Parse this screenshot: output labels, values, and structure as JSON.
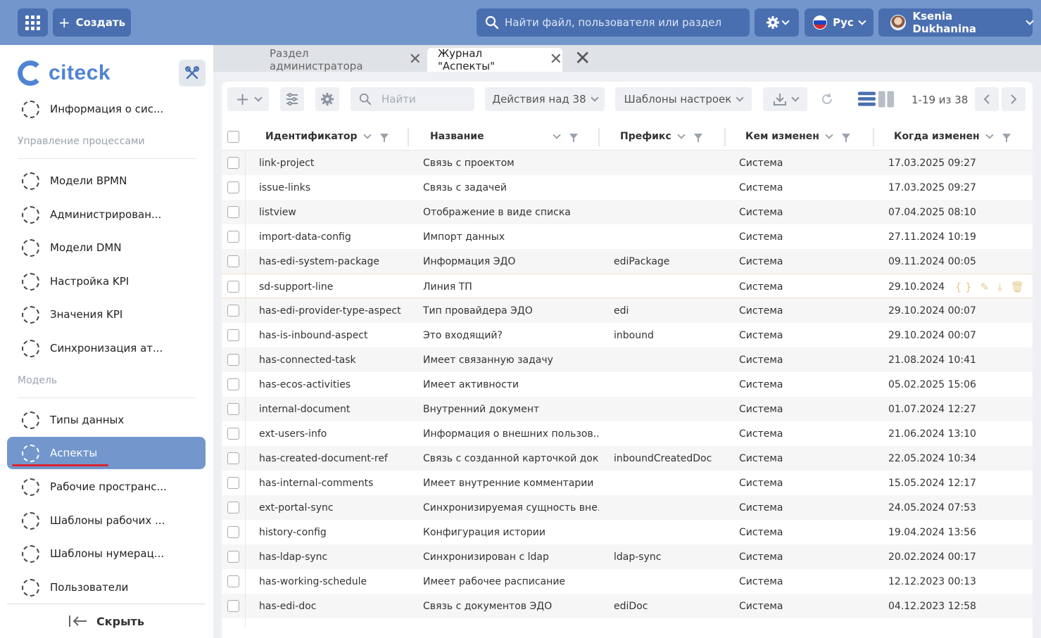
{
  "topbar": {
    "create_label": "Создать",
    "search_placeholder": "Найти файл, пользователя или раздел",
    "language": "Рус",
    "user_name": "Ksenia Dukhanina"
  },
  "sidebar": {
    "logo_text": "citeck",
    "top_item": "Информация о сис...",
    "section_processes": "Управление процессами",
    "process_items": [
      "Модели BPMN",
      "Администрирован...",
      "Модели DMN",
      "Настройка KPI",
      "Значения KPI",
      "Синхронизация ат..."
    ],
    "section_model": "Модель",
    "model_items": [
      "Типы данных",
      "Аспекты",
      "Рабочие пространс...",
      "Шаблоны рабочих ...",
      "Шаблоны нумерац...",
      "Пользователи"
    ],
    "active_item": "Аспекты",
    "hide_label": "Скрыть"
  },
  "tabs": [
    {
      "label": "Раздел администратора",
      "active": false
    },
    {
      "label": "Журнал \"Аспекты\"",
      "active": true
    }
  ],
  "toolbar": {
    "search_placeholder": "Найти",
    "actions_label": "Действия над 38",
    "templates_label": "Шаблоны настроек",
    "pager": "1-19 из 38"
  },
  "table": {
    "columns": [
      "Идентификатор",
      "Название",
      "Префикс",
      "Кем изменен",
      "Когда изменен"
    ],
    "rows": [
      [
        "link-project",
        "Связь с проектом",
        "",
        "Система",
        "17.03.2025 09:27"
      ],
      [
        "issue-links",
        "Связь с задачей",
        "",
        "Система",
        "17.03.2025 09:27"
      ],
      [
        "listview",
        "Отображение в виде списка",
        "",
        "Система",
        "07.04.2025 08:10"
      ],
      [
        "import-data-config",
        "Импорт данных",
        "",
        "Система",
        "27.11.2024 10:19"
      ],
      [
        "has-edi-system-package",
        "Информация ЭДО",
        "ediPackage",
        "Система",
        "09.11.2024 00:05"
      ],
      [
        "sd-support-line",
        "Линия ТП",
        "",
        "Система",
        "29.10.2024"
      ],
      [
        "has-edi-provider-type-aspect",
        "Тип провайдера ЭДО",
        "edi",
        "Система",
        "29.10.2024 00:07"
      ],
      [
        "has-is-inbound-aspect",
        "Это входящий?",
        "inbound",
        "Система",
        "29.10.2024 00:07"
      ],
      [
        "has-connected-task",
        "Имеет связанную задачу",
        "",
        "Система",
        "21.08.2024 10:41"
      ],
      [
        "has-ecos-activities",
        "Имеет активности",
        "",
        "Система",
        "05.02.2025 15:06"
      ],
      [
        "internal-document",
        "Внутренний документ",
        "",
        "Система",
        "01.07.2024 12:27"
      ],
      [
        "ext-users-info",
        "Информация о внешних пользов...",
        "",
        "Система",
        "21.06.2024 13:10"
      ],
      [
        "has-created-document-ref",
        "Связь с созданной карточкой док...",
        "inboundCreatedDoc",
        "Система",
        "22.05.2024 10:34"
      ],
      [
        "has-internal-comments",
        "Имеет внутренние комментарии",
        "",
        "Система",
        "15.05.2024 12:17"
      ],
      [
        "ext-portal-sync",
        "Синхронизируемая сущность вне...",
        "",
        "Система",
        "24.05.2024 07:53"
      ],
      [
        "history-config",
        "Конфигурация истории",
        "",
        "Система",
        "19.04.2024 13:56"
      ],
      [
        "has-ldap-sync",
        "Синхронизирован с ldap",
        "ldap-sync",
        "Система",
        "20.02.2024 00:17"
      ],
      [
        "has-working-schedule",
        "Имеет рабочее расписание",
        "",
        "Система",
        "12.12.2023 00:13"
      ],
      [
        "has-edi-doc",
        "Связь с документов ЭДО",
        "ediDoc",
        "Система",
        "04.12.2023 12:58"
      ]
    ],
    "hover_row": 5
  },
  "colors": {
    "topbar": "#7396cc",
    "button": "#4a6fb0",
    "brand": "#4f84d4",
    "active_nav": "#7396cc",
    "underline": "#d9232d"
  }
}
